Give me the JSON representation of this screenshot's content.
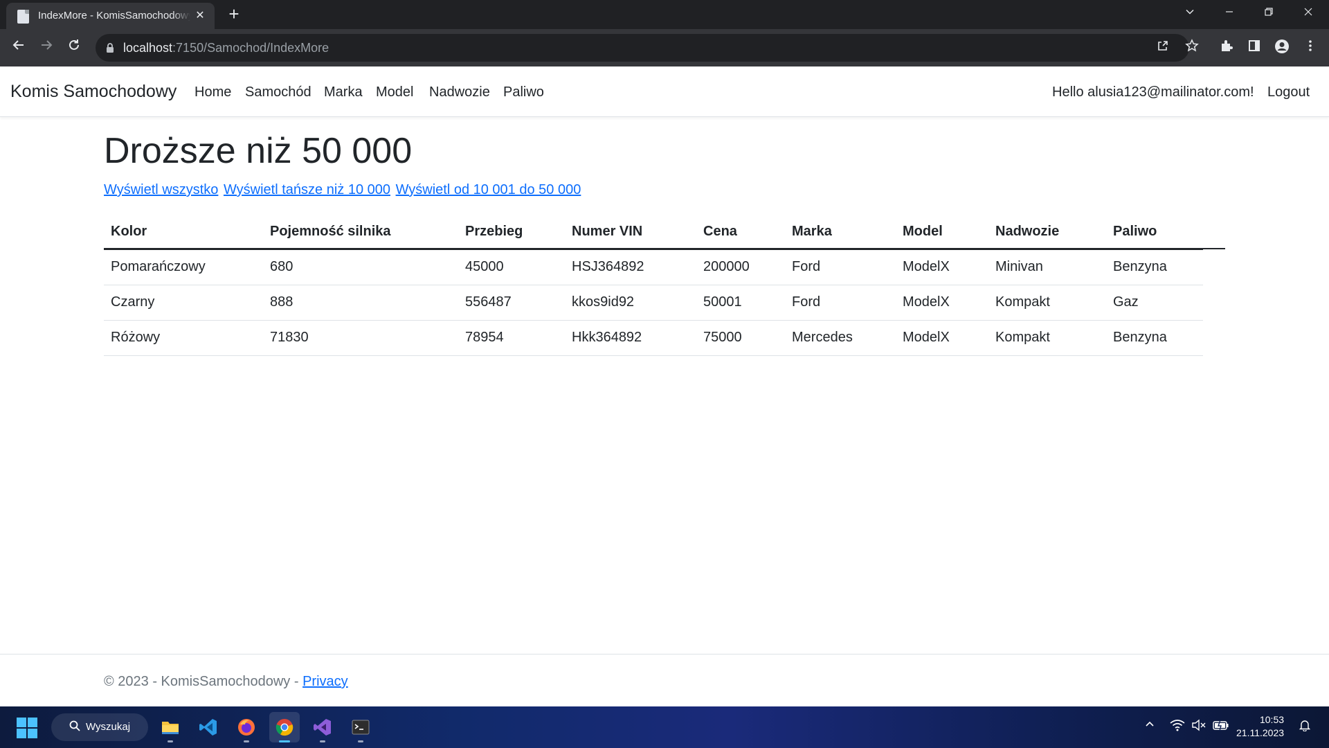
{
  "browser": {
    "tab_title": "IndexMore - KomisSamochodowy",
    "url_host": "localhost",
    "url_path": ":7150/Samochod/IndexMore",
    "newtab_icon": "plus-icon"
  },
  "navbar": {
    "brand": "Komis Samochodowy",
    "links": [
      "Home",
      "Samochód",
      "Marka",
      "Model",
      "Nadwozie",
      "Paliwo"
    ],
    "greeting": "Hello alusia123@mailinator.com!",
    "logout": "Logout"
  },
  "page": {
    "heading": "Droższe niż 50 000",
    "filters": [
      "Wyświetl wszystko",
      "Wyświetl tańsze niż 10 000",
      "Wyświetl od 10 001 do 50 000"
    ]
  },
  "table": {
    "headers": [
      "Kolor",
      "Pojemność silnika",
      "Przebieg",
      "Numer VIN",
      "Cena",
      "Marka",
      "Model",
      "Nadwozie",
      "Paliwo"
    ],
    "rows": [
      [
        "Pomarańczowy",
        "680",
        "45000",
        "HSJ364892",
        "200000",
        "Ford",
        "ModelX",
        "Minivan",
        "Benzyna"
      ],
      [
        "Czarny",
        "888",
        "556487",
        "kkos9id92",
        "50001",
        "Ford",
        "ModelX",
        "Kompakt",
        "Gaz"
      ],
      [
        "Różowy",
        "71830",
        "78954",
        "Hkk364892",
        "75000",
        "Mercedes",
        "ModelX",
        "Kompakt",
        "Benzyna"
      ]
    ]
  },
  "footer": {
    "copyright": "© 2023 - KomisSamochodowy - ",
    "privacy": "Privacy"
  },
  "taskbar": {
    "search_label": "Wyszukaj",
    "time": "10:53",
    "date": "21.11.2023"
  },
  "colors": {
    "link": "#0d6efd",
    "chrome_dark": "#202124",
    "chrome_toolbar": "#35363a",
    "windows_accent": "#4cc2ff"
  }
}
